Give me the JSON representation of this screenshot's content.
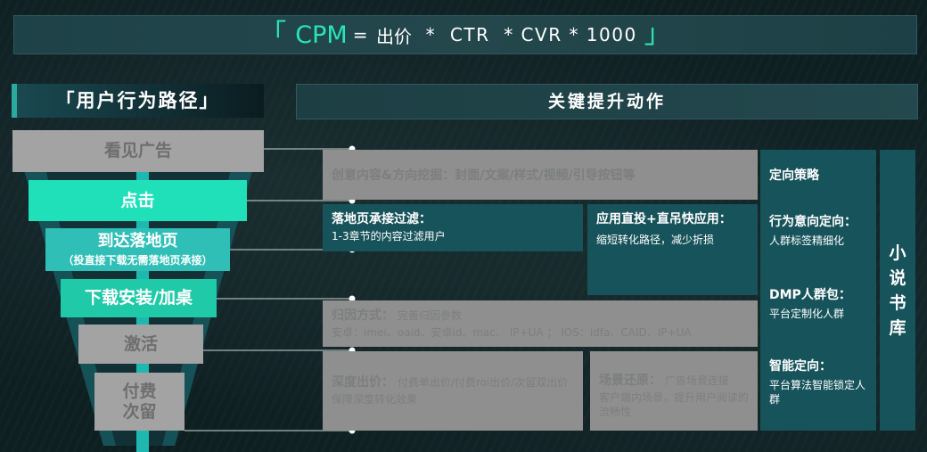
{
  "formula": {
    "open": "「",
    "cpm": "CPM",
    "eq": "=",
    "bid": "出价",
    "rest": "  *  CTR  * CVR * 1000",
    "close": "」"
  },
  "headers": {
    "user_path": "「用户行为路径」",
    "key_actions": "关键提升动作"
  },
  "stages": [
    {
      "title": "看见广告",
      "sub": ""
    },
    {
      "title": "点击",
      "sub": ""
    },
    {
      "title": "到达落地页",
      "sub": "（投直接下载无需落地页承接）"
    },
    {
      "title": "下载安装/加桌",
      "sub": ""
    },
    {
      "title": "激活",
      "sub": ""
    },
    {
      "title": "付费",
      "title2": "次留"
    }
  ],
  "actions": {
    "creative": {
      "title": "创意内容&方向挖掘：封面/文案/样式/视频/引导按钮等"
    },
    "landing": {
      "title": "落地页承接过滤：",
      "desc": "1-3章节的内容过滤用户"
    },
    "app_direct": {
      "title": "应用直投+直吊快应用：",
      "desc": "缩短转化路径，减少折损"
    },
    "attribution": {
      "title": "归因方式：",
      "title_tail": "完善归因参数",
      "desc": "安卓：imei、oaid、安卓id、mac、 IP+UA  ；  IOS：idfa、CAID、IP+UA"
    },
    "deep_bid": {
      "title": "深度出价：",
      "title_tail": "付费单出价/付费roi出价/次留双出价",
      "desc": "保障深度转化效果"
    },
    "scene": {
      "title": "场景还原：",
      "title_tail": "广告场景连接",
      "desc": "客户端内场景，提升用户阅读的流畅性"
    }
  },
  "targeting": {
    "title": "定向策略",
    "sections": [
      {
        "title": "行为意向定向：",
        "desc": "人群标签精细化"
      },
      {
        "title": "DMP人群包：",
        "desc": "平台定制化人群"
      },
      {
        "title": "智能定向：",
        "desc": "平台算法智能锁定人群"
      }
    ]
  },
  "novel_library": [
    "小",
    "说",
    "书",
    "库"
  ],
  "colors": {
    "accent": "#28e6b6",
    "teal_stage": "#1fd1b0",
    "grey_stage": "#a0a0a0",
    "panel_dark": "#17535b",
    "panel_grey": "#8e8e8e"
  }
}
